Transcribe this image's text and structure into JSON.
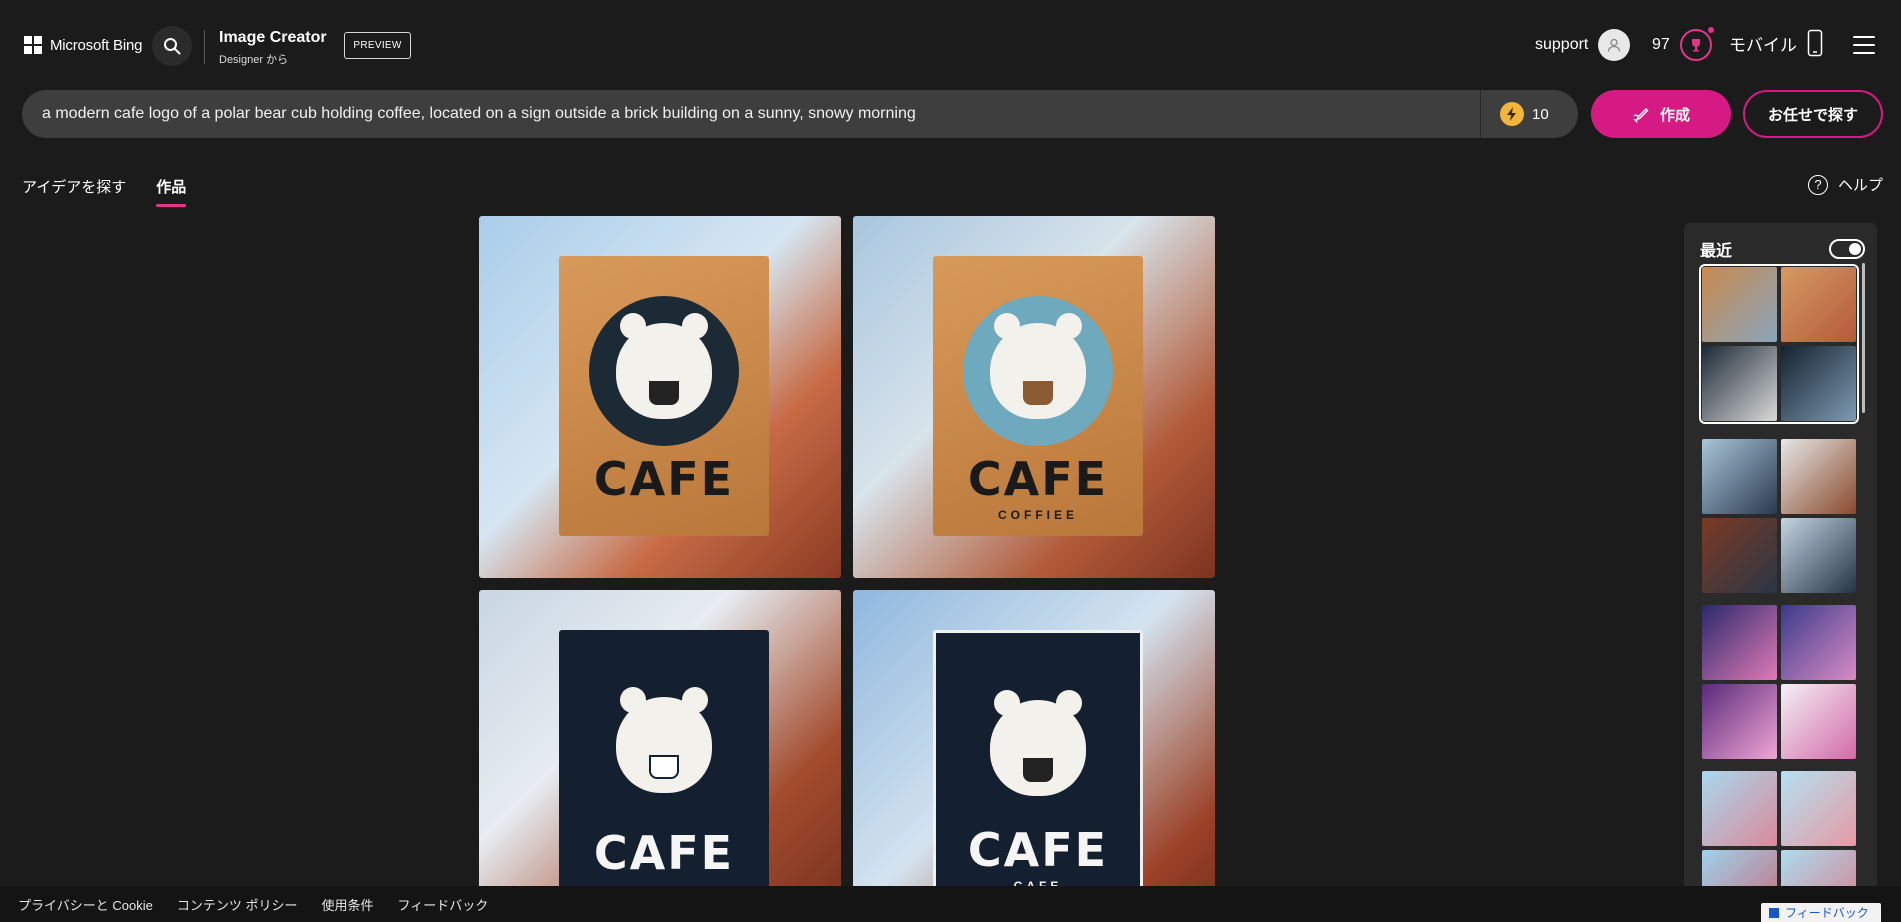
{
  "header": {
    "brand": "Microsoft Bing",
    "product_title": "Image Creator",
    "product_sub": "Designer から",
    "preview_badge": "PREVIEW",
    "user_name": "support",
    "points": "97",
    "mobile_label": "モバイル"
  },
  "prompt": {
    "text": "a modern cafe logo of a polar bear cub holding coffee, located on a sign outside a brick building on a sunny, snowy morning",
    "boosts": "10",
    "create_label": "作成",
    "surprise_label": "お任せで探す"
  },
  "tabs": [
    {
      "label": "アイデアを探す",
      "active": false
    },
    {
      "label": "作品",
      "active": true
    }
  ],
  "help_label": "ヘルプ",
  "results": [
    {
      "sign_text": "CAFE",
      "sub_text": ""
    },
    {
      "sign_text": "CAFE",
      "sub_text": "COFFIEE"
    },
    {
      "sign_text": "CAFE",
      "sub_text": ""
    },
    {
      "sign_text": "CAFE",
      "sub_text": "CAFE"
    }
  ],
  "recent": {
    "title": "最近"
  },
  "footer": {
    "links": [
      "プライバシーと Cookie",
      "コンテンツ ポリシー",
      "使用条件",
      "フィードバック"
    ],
    "feedback_button": "フィードバック"
  },
  "colors": {
    "accent": "#d61a84",
    "background": "#1b1b1b"
  }
}
